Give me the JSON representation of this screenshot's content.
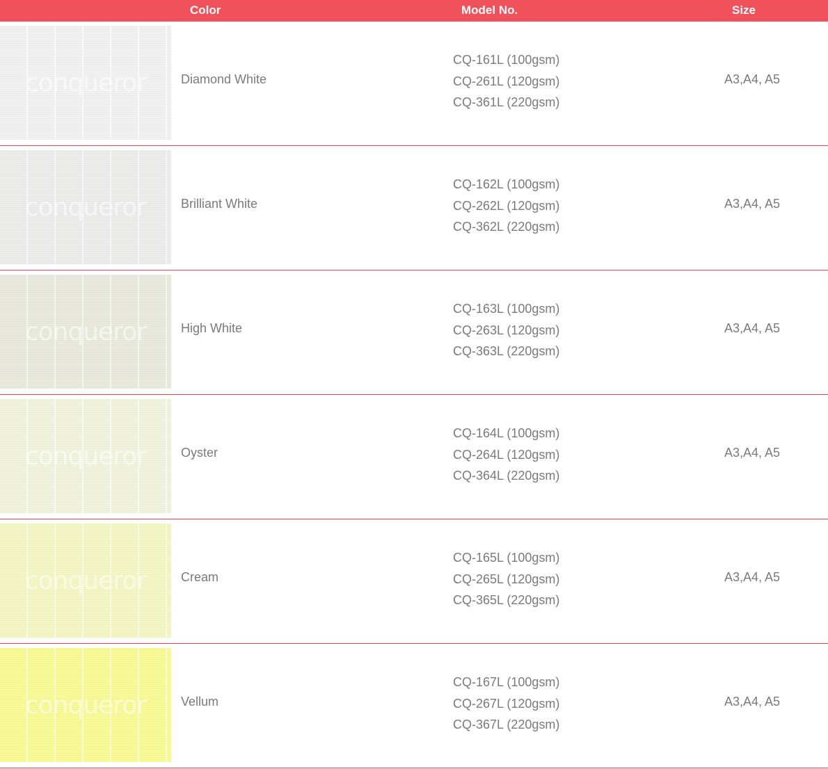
{
  "header": {
    "color": "Color",
    "model": "Model No.",
    "size": "Size"
  },
  "colors": {
    "header_bg": "#f1515a",
    "divider": "#d9434c",
    "text": "#7a7a7a"
  },
  "rows": [
    {
      "name": "Diamond White",
      "swatch": "#f1f1f1",
      "watermark": "conqueror",
      "models": [
        "CQ-161L (100gsm)",
        "CQ-261L (120gsm)",
        "CQ-361L (220gsm)"
      ],
      "size": "A3,A4, A5"
    },
    {
      "name": "Brilliant White",
      "swatch": "#ececea",
      "watermark": "conqueror",
      "models": [
        "CQ-162L (100gsm)",
        "CQ-262L (120gsm)",
        "CQ-362L (220gsm)"
      ],
      "size": "A3,A4, A5"
    },
    {
      "name": "High White",
      "swatch": "#e9eadd",
      "watermark": "conqueror",
      "models": [
        "CQ-163L (100gsm)",
        "CQ-263L (120gsm)",
        "CQ-363L (220gsm)"
      ],
      "size": "A3,A4, A5"
    },
    {
      "name": "Oyster",
      "swatch": "#f1f3dc",
      "watermark": "conqueror",
      "models": [
        "CQ-164L (100gsm)",
        "CQ-264L (120gsm)",
        "CQ-364L (220gsm)"
      ],
      "size": "A3,A4, A5"
    },
    {
      "name": "Cream",
      "swatch": "#f4f6c4",
      "watermark": "conqueror",
      "models": [
        "CQ-165L (100gsm)",
        "CQ-265L (120gsm)",
        "CQ-365L (220gsm)"
      ],
      "size": "A3,A4, A5"
    },
    {
      "name": "Vellum",
      "swatch": "#f8fa98",
      "watermark": "conqueror",
      "models": [
        "CQ-167L (100gsm)",
        "CQ-267L (120gsm)",
        "CQ-367L (220gsm)"
      ],
      "size": "A3,A4, A5"
    }
  ]
}
